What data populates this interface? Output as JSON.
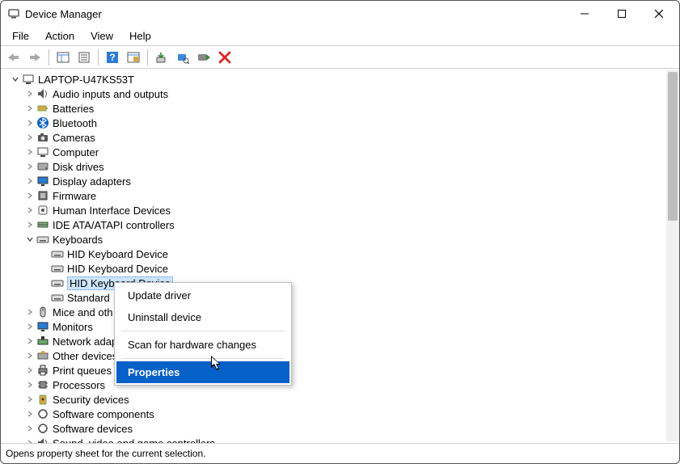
{
  "window": {
    "title": "Device Manager"
  },
  "menu": [
    "File",
    "Action",
    "View",
    "Help"
  ],
  "tree": {
    "root": "LAPTOP-U47KS53T",
    "nodes": [
      {
        "label": "Audio inputs and outputs",
        "icon": "audio-icon",
        "expanded": false
      },
      {
        "label": "Batteries",
        "icon": "battery-icon",
        "expanded": false
      },
      {
        "label": "Bluetooth",
        "icon": "bluetooth-icon",
        "expanded": false
      },
      {
        "label": "Cameras",
        "icon": "camera-icon",
        "expanded": false
      },
      {
        "label": "Computer",
        "icon": "computer-icon",
        "expanded": false
      },
      {
        "label": "Disk drives",
        "icon": "disk-icon",
        "expanded": false
      },
      {
        "label": "Display adapters",
        "icon": "display-icon",
        "expanded": false
      },
      {
        "label": "Firmware",
        "icon": "firmware-icon",
        "expanded": false
      },
      {
        "label": "Human Interface Devices",
        "icon": "hid-icon",
        "expanded": false
      },
      {
        "label": "IDE ATA/ATAPI controllers",
        "icon": "ide-icon",
        "expanded": false
      },
      {
        "label": "Keyboards",
        "icon": "keyboard-icon",
        "expanded": true,
        "children": [
          {
            "label": "HID Keyboard Device",
            "icon": "keyboard-icon"
          },
          {
            "label": "HID Keyboard Device",
            "icon": "keyboard-icon"
          },
          {
            "label": "HID Keyboard Device",
            "icon": "keyboard-icon",
            "selected": true
          },
          {
            "label": "Standard",
            "icon": "keyboard-icon",
            "truncated": true
          }
        ]
      },
      {
        "label": "Mice and oth",
        "icon": "mouse-icon",
        "expanded": false,
        "truncated": true
      },
      {
        "label": "Monitors",
        "icon": "monitor-icon",
        "expanded": false
      },
      {
        "label": "Network adap",
        "icon": "network-icon",
        "expanded": false,
        "truncated": true
      },
      {
        "label": "Other devices",
        "icon": "other-icon",
        "expanded": false,
        "truncated": true
      },
      {
        "label": "Print queues",
        "icon": "printer-icon",
        "expanded": false
      },
      {
        "label": "Processors",
        "icon": "cpu-icon",
        "expanded": false
      },
      {
        "label": "Security devices",
        "icon": "security-icon",
        "expanded": false
      },
      {
        "label": "Software components",
        "icon": "software-icon",
        "expanded": false
      },
      {
        "label": "Software devices",
        "icon": "software-icon",
        "expanded": false
      },
      {
        "label": "Sound, video and game controllers",
        "icon": "audio-icon",
        "expanded": false,
        "truncated": true
      }
    ]
  },
  "context_menu": {
    "items": [
      {
        "label": "Update driver"
      },
      {
        "label": "Uninstall device"
      },
      {
        "sep": true
      },
      {
        "label": "Scan for hardware changes"
      },
      {
        "sep": true
      },
      {
        "label": "Properties",
        "hover": true
      }
    ]
  },
  "status": "Opens property sheet for the current selection."
}
